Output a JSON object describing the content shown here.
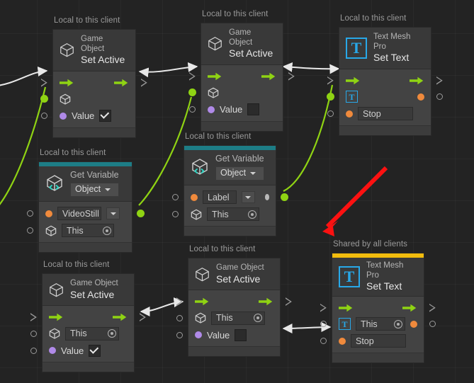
{
  "graph": {
    "background_color": "#232323",
    "accent_teal": "#1d7d86",
    "accent_gold": "#f2bc0d",
    "flow_green": "#8fd313",
    "wire_white": "#e8e8e8",
    "annotation_red": "#fb1111"
  },
  "scope_labels": {
    "local": "Local to this client",
    "shared": "Shared by all clients"
  },
  "nodes": [
    {
      "id": "set-active-1",
      "caption": "Local to this client",
      "header_sub": "Game Object",
      "header_main": "Set Active",
      "header_icon": "cube-icon",
      "value_label": "Value",
      "value_checked": true
    },
    {
      "id": "set-active-2",
      "caption": "Local to this client",
      "header_sub": "Game Object",
      "header_main": "Set Active",
      "header_icon": "cube-icon",
      "value_label": "Value",
      "value_checked": false
    },
    {
      "id": "set-text-1",
      "caption": "Local to this client",
      "header_sub": "Text Mesh Pro",
      "header_main": "Set Text",
      "header_icon": "textmeshpro-icon",
      "header_glyph": "T",
      "text_value": "Stop"
    },
    {
      "id": "get-variable-1",
      "caption": "Local to this client",
      "header_sub": "Get Variable",
      "header_icon": "cube-code-icon",
      "kind_dropdown": "Object",
      "variable_name": "VideoStill",
      "target_value": "This"
    },
    {
      "id": "get-variable-2",
      "caption": "Local to this client",
      "header_sub": "Get Variable",
      "header_icon": "cube-code-icon",
      "kind_dropdown": "Object",
      "variable_name": "Label",
      "target_value": "This"
    },
    {
      "id": "set-active-3",
      "caption": "Local to this client",
      "header_sub": "Game Object",
      "header_main": "Set Active",
      "header_icon": "cube-icon",
      "target_value": "This",
      "value_label": "Value",
      "value_checked": true
    },
    {
      "id": "set-active-4",
      "caption": "Local to this client",
      "header_sub": "Game Object",
      "header_main": "Set Active",
      "header_icon": "cube-icon",
      "target_value": "This",
      "value_label": "Value",
      "value_checked": false
    },
    {
      "id": "set-text-2",
      "caption": "Shared by all clients",
      "header_sub": "Text Mesh Pro",
      "header_main": "Set Text",
      "header_icon": "textmeshpro-icon",
      "header_glyph": "T",
      "target_value": "This",
      "text_value": "Stop"
    }
  ],
  "annotation": {
    "name": "red-arrow-annotation",
    "color": "#fb1111"
  }
}
